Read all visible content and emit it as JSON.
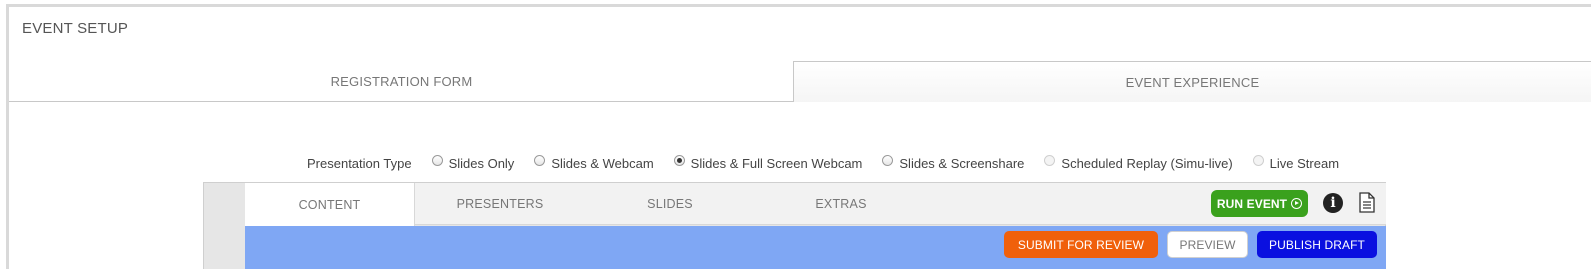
{
  "page": {
    "title": "EVENT SETUP"
  },
  "main_tabs": [
    {
      "label": "REGISTRATION FORM",
      "active": false
    },
    {
      "label": "EVENT EXPERIENCE",
      "active": true
    }
  ],
  "presentation_type": {
    "label": "Presentation Type",
    "options": [
      {
        "label": "Slides Only",
        "selected": false,
        "enabled": true
      },
      {
        "label": "Slides & Webcam",
        "selected": false,
        "enabled": true
      },
      {
        "label": "Slides & Full Screen Webcam",
        "selected": true,
        "enabled": true
      },
      {
        "label": "Slides & Screenshare",
        "selected": false,
        "enabled": true
      },
      {
        "label": "Scheduled Replay (Simu-live)",
        "selected": false,
        "enabled": false
      },
      {
        "label": "Live Stream",
        "selected": false,
        "enabled": false
      }
    ]
  },
  "sub_tabs": [
    {
      "label": "CONTENT",
      "active": true
    },
    {
      "label": "PRESENTERS",
      "active": false
    },
    {
      "label": "SLIDES",
      "active": false
    },
    {
      "label": "EXTRAS",
      "active": false
    }
  ],
  "toolbar": {
    "run_event_label": "RUN EVENT",
    "info_icon": "info-circle-icon",
    "doc_icon": "document-icon"
  },
  "actions": {
    "submit_label": "SUBMIT FOR REVIEW",
    "preview_label": "PREVIEW",
    "publish_label": "PUBLISH DRAFT"
  },
  "colors": {
    "run_event": "#3aa11d",
    "action_bar": "#7fa7f4",
    "submit": "#f0600b",
    "publish": "#0a10e0"
  }
}
